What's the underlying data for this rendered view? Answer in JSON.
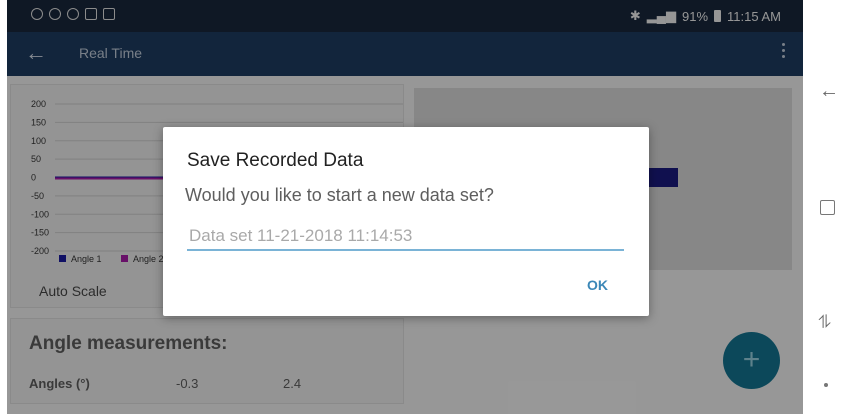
{
  "status_bar": {
    "battery": "91%",
    "time": "11:15 AM"
  },
  "app_bar": {
    "back_icon": "arrow-left-icon",
    "title": "Real Time",
    "menu_icon": "more-vert-icon"
  },
  "chart_data": {
    "type": "line",
    "y_ticks": [
      "200",
      "150",
      "100",
      "50",
      "0",
      "-50",
      "-100",
      "-150",
      "-200"
    ],
    "ylim": [
      -200,
      200
    ],
    "series": [
      {
        "name": "Angle 1",
        "color": "#1a1a9a",
        "values": [
          0,
          0
        ]
      },
      {
        "name": "Angle 2",
        "color": "#a01aa0",
        "values": [
          0,
          0
        ]
      }
    ],
    "legend_position": "bottom-left"
  },
  "chart_options": {
    "auto_scale_label": "Auto Scale"
  },
  "angle_panel": {
    "title": "Angle measurements:",
    "row_label": "Angles (°)",
    "values": [
      "-0.3",
      "2.4"
    ]
  },
  "fab": {
    "icon": "plus-icon",
    "label": "+"
  },
  "dialog": {
    "title": "Save Recorded Data",
    "message": "Would you like to start a new data set?",
    "input_placeholder": "Data set 11-21-2018 11:14:53",
    "input_value": "",
    "ok_label": "OK"
  },
  "nav_bar": {
    "back_icon": "nav-back-icon",
    "home_icon": "nav-home-icon",
    "recent_icon": "nav-recent-icon"
  }
}
